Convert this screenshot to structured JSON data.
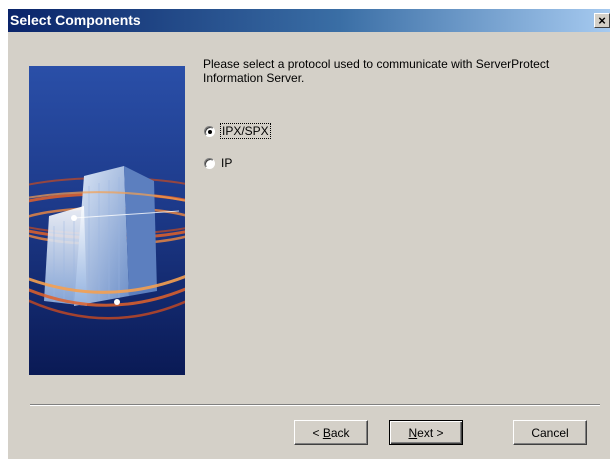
{
  "window": {
    "title": "Select Components",
    "close_glyph": "×"
  },
  "prompt": "Please select a protocol used to communicate with ServerProtect Information Server.",
  "options": [
    {
      "label": "IPX/SPX",
      "selected": true
    },
    {
      "label": "IP",
      "selected": false
    }
  ],
  "buttons": {
    "back": {
      "accel": "B",
      "rest": "ack",
      "prefix": "< "
    },
    "next": {
      "accel": "N",
      "rest": "ext >"
    },
    "cancel": "Cancel"
  },
  "colors": {
    "title_start": "#0a246a",
    "title_end": "#a6caf0",
    "face": "#d4d0c8"
  }
}
